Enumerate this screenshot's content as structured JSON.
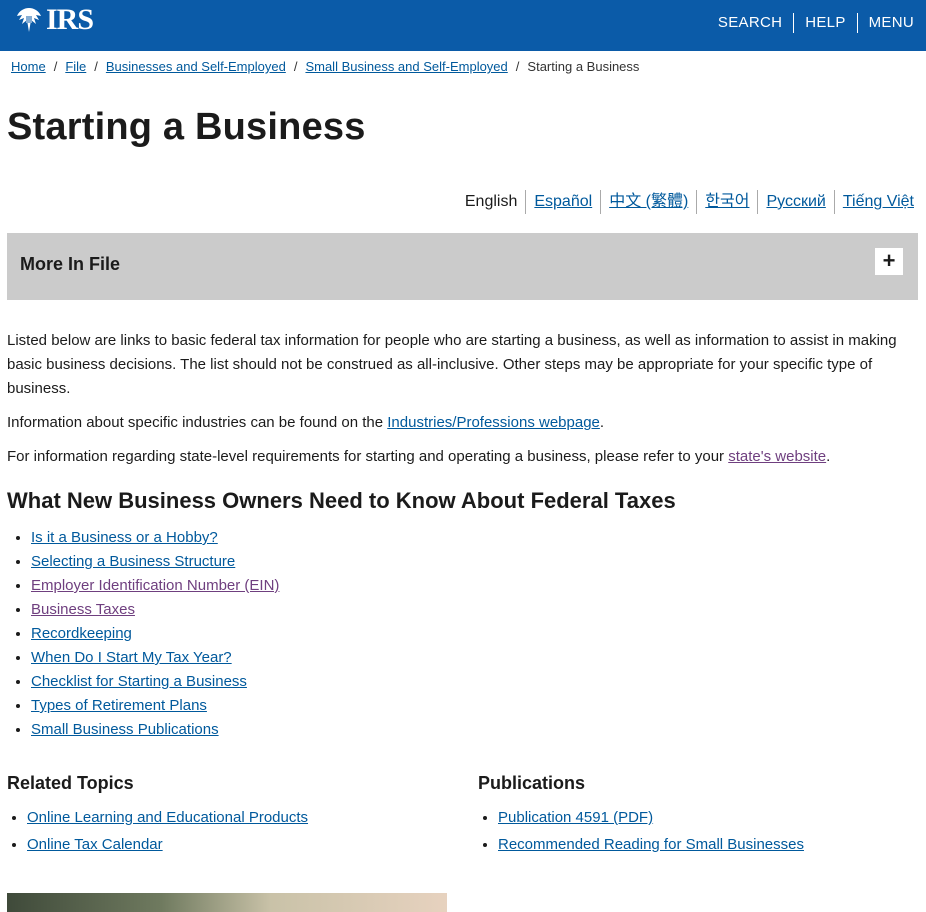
{
  "header": {
    "logo_text": "IRS",
    "nav": [
      "SEARCH",
      "HELP",
      "MENU"
    ]
  },
  "breadcrumb": {
    "links": [
      "Home",
      "File",
      "Businesses and Self-Employed",
      "Small Business and Self-Employed"
    ],
    "current": "Starting a Business"
  },
  "page_title": "Starting a Business",
  "languages": {
    "current": "English",
    "links": [
      "Español",
      "中文 (繁體)",
      "한국어",
      "Русский",
      "Tiếng Việt"
    ]
  },
  "more_in_file": {
    "label": "More In File",
    "toggle": "+"
  },
  "intro": {
    "p1": "Listed below are links to basic federal tax information for people who are starting a business, as well as information to assist in making basic business decisions. The list should not be construed as all-inclusive. Other steps may be appropriate for your specific type of business.",
    "p2_before": "Information about specific industries can be found on the ",
    "p2_link": "Industries/Professions webpage",
    "p2_after": ".",
    "p3_before": "For information regarding state-level requirements for starting and operating a business, please refer to your ",
    "p3_link": "state's website",
    "p3_after": "."
  },
  "section_heading": "What New Business Owners Need to Know About Federal Taxes",
  "topic_links": [
    "Is it a Business or a Hobby?",
    "Selecting a Business Structure",
    "Employer Identification Number (EIN)",
    "Business Taxes",
    "Recordkeeping",
    "When Do I Start My Tax Year?",
    "Checklist for Starting a Business",
    "Types of Retirement Plans",
    "Small Business Publications"
  ],
  "related_topics": {
    "heading": "Related Topics",
    "links": [
      "Online Learning and Educational Products",
      "Online Tax Calendar"
    ]
  },
  "publications": {
    "heading": "Publications",
    "links": [
      "Publication 4591 (PDF)",
      "Recommended Reading for Small Businesses"
    ]
  },
  "colors": {
    "header_bg": "#0b5ba8",
    "link": "#00599c",
    "visited": "#6f3f7f",
    "accordion_bg": "#cbcbcb"
  }
}
